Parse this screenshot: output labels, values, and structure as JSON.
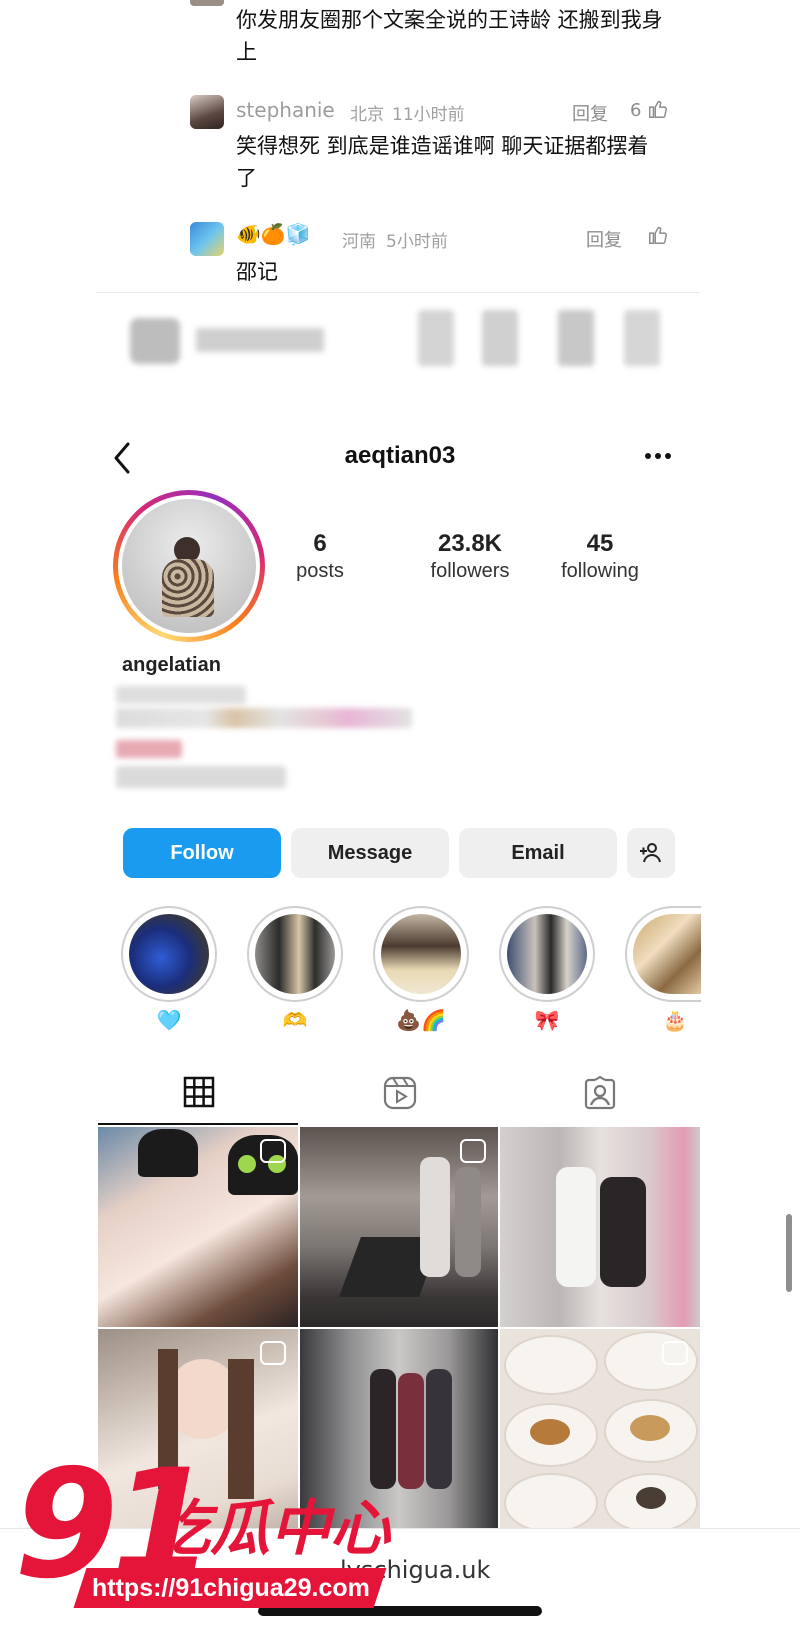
{
  "comments": [
    {
      "text": "你发朋友圈那个文案全说的王诗龄 还搬到我身上"
    },
    {
      "name": "stephanie",
      "location": "北京",
      "time": "11小时前",
      "reply": "回复",
      "likes": "6",
      "text": "笑得想死 到底是谁造谣谁啊 聊天证据都摆着了"
    },
    {
      "name": "🐠🍊🧊",
      "location": "河南",
      "time": "5小时前",
      "reply": "回复",
      "likes": "",
      "text": "邵记"
    }
  ],
  "profile": {
    "header_username": "aeqtian03",
    "stats": [
      {
        "value": "6",
        "label": "posts"
      },
      {
        "value": "23.8K",
        "label": "followers"
      },
      {
        "value": "45",
        "label": "following"
      }
    ],
    "display_name": "angelatian",
    "buttons": {
      "follow": "Follow",
      "message": "Message",
      "email": "Email"
    },
    "highlights": [
      {
        "emoji": "🩵",
        "color": "#2c3b8c"
      },
      {
        "emoji": "🫶",
        "color": "#6d6a66"
      },
      {
        "emoji": "💩🌈",
        "color": "#b89b7a"
      },
      {
        "emoji": "🎀",
        "color": "#52617e"
      },
      {
        "emoji": "🎂",
        "color": "#a88858"
      }
    ]
  },
  "watermark": {
    "number": "91",
    "brand": "吃瓜中心",
    "url": "https://91chigua29.com",
    "address_bar": "lyschigua.uk"
  }
}
